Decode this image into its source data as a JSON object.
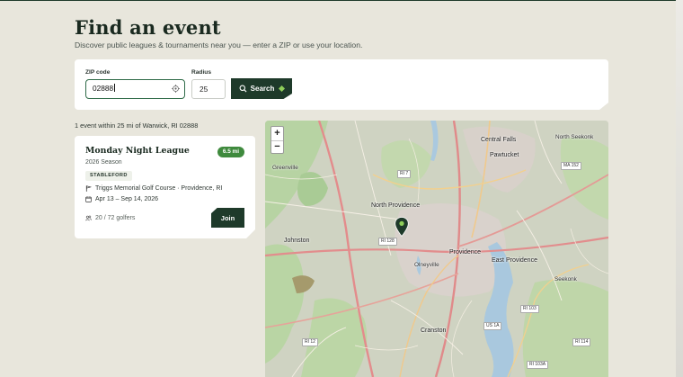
{
  "page": {
    "title": "Find an event",
    "subtitle": "Discover public leagues & tournaments near you — enter a ZIP or use your location."
  },
  "search": {
    "zip_label": "ZIP code",
    "zip_value": "02888",
    "radius_label": "Radius",
    "radius_value": "25",
    "search_label": "Search"
  },
  "results": {
    "count_text": "1 event within 25 mi of Warwick, RI 02888"
  },
  "events": [
    {
      "title": "Monday Night League",
      "season": "2026 Season",
      "distance": "6.5 mi",
      "format": "STABLEFORD",
      "course": "Triggs Memorial Golf Course · Providence, RI",
      "dates": "Apr 13 – Sep 14, 2026",
      "golfers": "20 / 72 golfers",
      "join_label": "Join"
    }
  ],
  "map": {
    "zoom_in": "+",
    "zoom_out": "−",
    "places": {
      "central_falls": "Central Falls",
      "north_seekonk": "North Seekonk",
      "pawtucket": "Pawtucket",
      "greenville": "Greenville",
      "north_providence": "North Providence",
      "johnston": "Johnston",
      "providence": "Providence",
      "east_providence": "East Providence",
      "olneyville": "Olneyville",
      "seekonk": "Seekonk",
      "cranston": "Cranston"
    },
    "shields": {
      "ma152": "MA 152",
      "ri7": "RI 7",
      "ri128": "RI 128",
      "ri103": "RI 103",
      "us1a": "US 1A",
      "ri12": "RI 12",
      "ri114": "RI 114",
      "ri103a": "RI 103A"
    }
  },
  "colors": {
    "brand_dark": "#1e3a2a",
    "accent_green": "#3f8a3d",
    "page_bg": "#e8e6dc"
  }
}
